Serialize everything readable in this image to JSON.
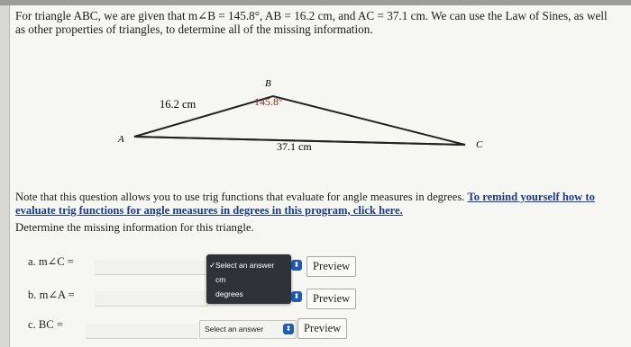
{
  "intro": {
    "text": "For triangle ABC, we are given that m∠B = 145.8°, AB = 16.2 cm, and AC = 37.1 cm. We can use the Law of Sines, as well as other properties of triangles, to determine all of the missing information."
  },
  "figure": {
    "vertex_a": "A",
    "vertex_b": "B",
    "vertex_c": "C",
    "side_ab": "16.2 cm",
    "angle_b": "145.8°",
    "side_ac": "37.1 cm"
  },
  "note": {
    "text": "Note that this question allows you to use trig functions that evaluate for angle measures in degrees. ",
    "link": "To remind yourself how to evaluate trig functions for angle measures in degrees in this program, click here."
  },
  "determine_label": "Determine the missing information for this triangle.",
  "questions": [
    {
      "label": "a. m∠C ="
    },
    {
      "label": "b. m∠A ="
    },
    {
      "label": "c. BC ="
    }
  ],
  "unit_menu": {
    "selected": "Select an answer",
    "options": [
      "cm",
      "degrees"
    ]
  },
  "select_placeholder": "Select an answer",
  "preview_label": "Preview",
  "colors": {
    "link": "#1b3a8a",
    "menu_bg": "#2f3338",
    "badge": "#1e5bb5"
  }
}
